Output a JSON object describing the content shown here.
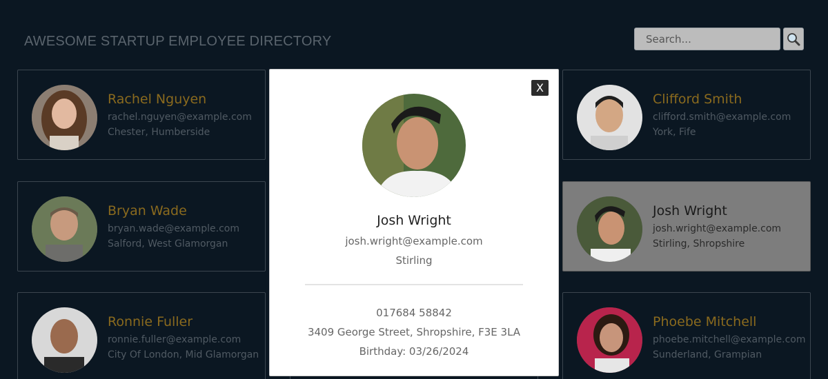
{
  "header": {
    "title": "AWESOME STARTUP EMPLOYEE DIRECTORY",
    "search_placeholder": "Search..."
  },
  "employees": [
    {
      "name": "Rachel Nguyen",
      "email": "rachel.nguyen@example.com",
      "location": "Chester, Humberside"
    },
    {
      "name": "Bryan Wade",
      "email": "bryan.wade@example.com",
      "location": "Salford, West Glamorgan"
    },
    {
      "name": "Ronnie Fuller",
      "email": "ronnie.fuller@example.com",
      "location": "City Of London, Mid Glamorgan"
    },
    {
      "name": "Clifford Smith",
      "email": "clifford.smith@example.com",
      "location": "York, Fife"
    },
    {
      "name": "Josh Wright",
      "email": "josh.wright@example.com",
      "location": "Stirling, Shropshire"
    },
    {
      "name": "Phoebe Mitchell",
      "email": "phoebe.mitchell@example.com",
      "location": "Sunderland, Grampian"
    }
  ],
  "modal": {
    "close_label": "X",
    "name": "Josh Wright",
    "email": "josh.wright@example.com",
    "city": "Stirling",
    "phone": "017684 58842",
    "address": "3409 George Street, Shropshire, F3E 3LA",
    "birthday": "Birthday: 03/26/2024"
  },
  "colors": {
    "background": "#0b1722",
    "name_accent": "#8a6a1e",
    "active_card": "#7d7d7d"
  }
}
